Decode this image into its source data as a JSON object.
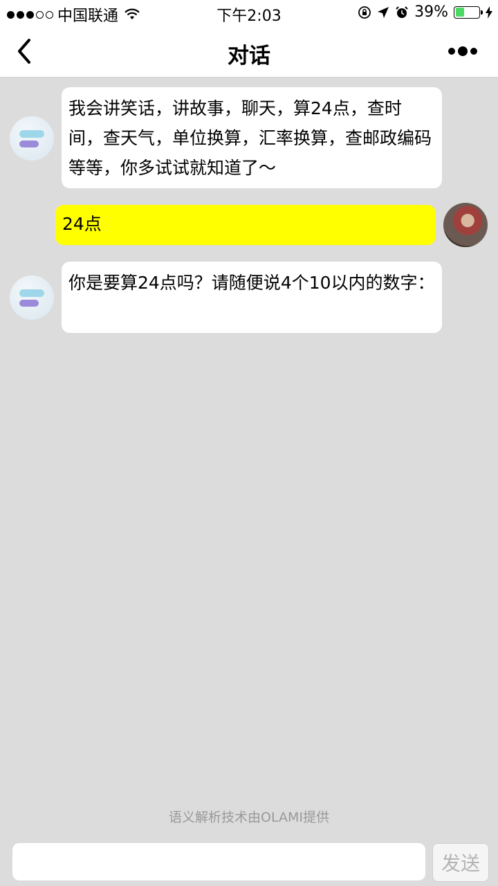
{
  "status_bar": {
    "carrier": "中国联通",
    "time": "下午2:03",
    "battery_percent": "39%",
    "battery_level": 0.39,
    "icons": [
      "signal-dots",
      "wifi-icon",
      "orientation-lock-icon",
      "location-arrow-icon",
      "alarm-icon",
      "battery-icon",
      "charging-icon"
    ]
  },
  "nav": {
    "title": "对话",
    "back_icon": "chevron-left-icon",
    "more_icon": "more-dots-icon"
  },
  "messages": [
    {
      "sender": "bot",
      "text": "我会讲笑话，讲故事，聊天，算24点，查时间，查天气，单位换算，汇率换算，查邮政编码等等，你多试试就知道了～"
    },
    {
      "sender": "user",
      "text": "24点"
    },
    {
      "sender": "bot",
      "text": "你是要算24点吗？请随便说4个10以内的数字："
    }
  ],
  "footer_note": "语义解析技术由OLAMI提供",
  "input": {
    "value": "",
    "placeholder": "",
    "send_label": "发送"
  },
  "colors": {
    "background": "#dcdcdc",
    "user_bubble": "#ffff00",
    "bot_bubble": "#ffffff",
    "battery_green": "#4cd964"
  }
}
